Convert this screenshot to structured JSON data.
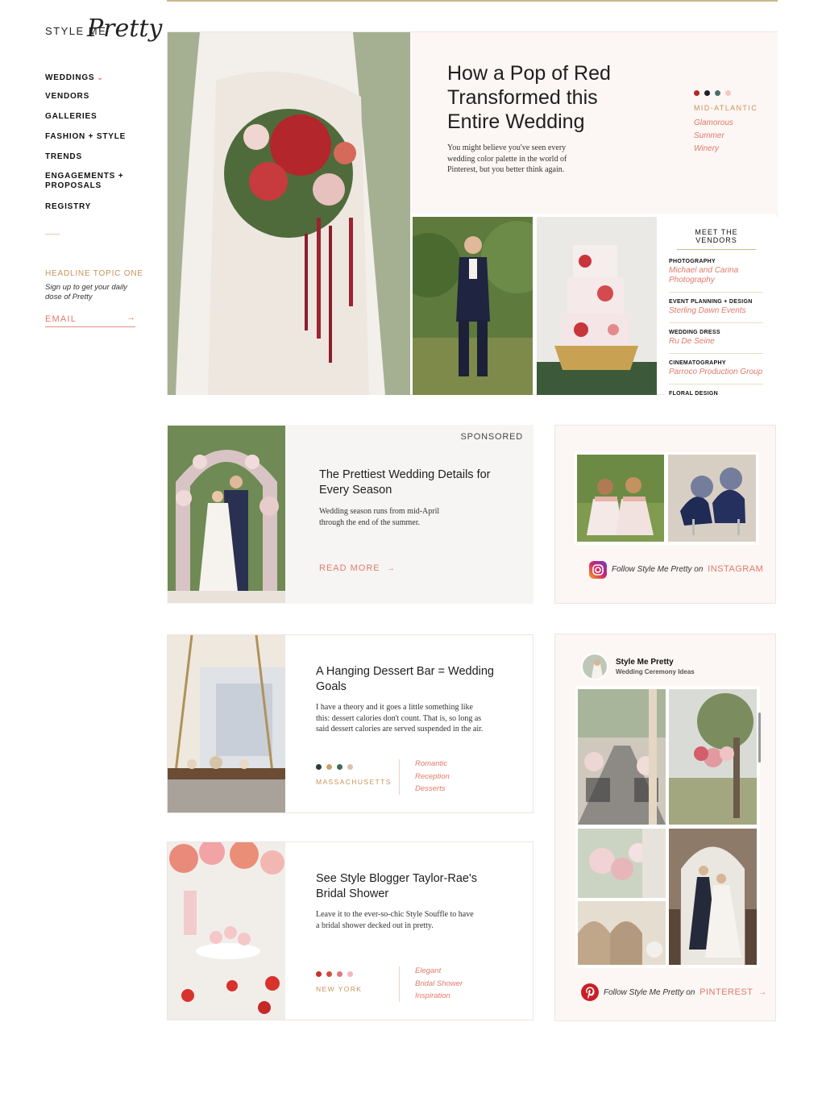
{
  "brand": {
    "logo_small": "STYLE ME",
    "logo_script": "Pretty"
  },
  "nav": {
    "items": [
      {
        "label": "WEDDINGS",
        "has_dropdown": true
      },
      {
        "label": "VENDORS"
      },
      {
        "label": "GALLERIES"
      },
      {
        "label": "FASHION + STYLE"
      },
      {
        "label": "TRENDS"
      },
      {
        "label": "ENGAGEMENTS +\nPROPOSALS"
      },
      {
        "label": "REGISTRY"
      }
    ]
  },
  "newsletter": {
    "title": "HEADLINE TOPIC ONE",
    "subtitle": "Sign up to get your daily dose of Pretty",
    "placeholder": "EMAIL"
  },
  "hero": {
    "title": "How a Pop of Red Transformed this Entire Wedding",
    "description": "You might believe you've seen every wedding color palette in the world of Pinterest, but you better think again.",
    "palette": [
      "#b3262c",
      "#1f1f2b",
      "#4b6e6a",
      "#f2c9c6"
    ],
    "region": "MID-ATLANTIC",
    "tags": [
      "Glamorous",
      "Summer",
      "Winery"
    ],
    "vendors_title": "MEET THE VENDORS",
    "vendors": [
      {
        "role": "PHOTOGRAPHY",
        "name": "Michael and Carina Photography"
      },
      {
        "role": "EVENT PLANNING + DESIGN",
        "name": "Sterling Dawn Events"
      },
      {
        "role": "WEDDING DRESS",
        "name": "Ru De Seine"
      },
      {
        "role": "CINEMATOGRAPHY",
        "name": "Parroco Production Group"
      },
      {
        "role": "FLORAL DESIGN",
        "name": ""
      }
    ]
  },
  "sponsored": {
    "label": "SPONSORED",
    "title": "The Prettiest Wedding Details for Every Season",
    "description": "Wedding season runs from mid-April through the end of the summer.",
    "read_more": "READ MORE"
  },
  "instagram": {
    "follow_text": "Follow Style Me Pretty on",
    "link": "INSTAGRAM"
  },
  "stories": [
    {
      "title": "A Hanging Dessert Bar = Wedding Goals",
      "description": "I have a theory and it goes a little something like this: dessert calories don't count. That is, so long as said dessert calories are served suspended in the air.",
      "palette": [
        "#2f3b33",
        "#c7a26c",
        "#3f6a5a",
        "#d9c3b0"
      ],
      "region": "MASSACHUSETTS",
      "tags": [
        "Romantic",
        "Reception",
        "Desserts"
      ]
    },
    {
      "title": "See Style Blogger Taylor-Rae's Bridal Shower",
      "description": "Leave it to the ever-so-chic Style Souffle to have a bridal shower decked out in pretty.",
      "palette": [
        "#c6302b",
        "#d54a3e",
        "#e2767b",
        "#f2b8bd"
      ],
      "region": "NEW YORK",
      "tags": [
        "Elegant",
        "Bridal Shower",
        "Inspiration"
      ]
    }
  ],
  "pinterest": {
    "account": "Style Me Pretty",
    "board": "Wedding Ceremony Ideas",
    "follow_text": "Follow Style Me Pretty on",
    "link": "PINTEREST"
  },
  "colors": {
    "accent": "#e07a6a",
    "gold": "#c8935a",
    "blush": "#fcf6f4"
  }
}
